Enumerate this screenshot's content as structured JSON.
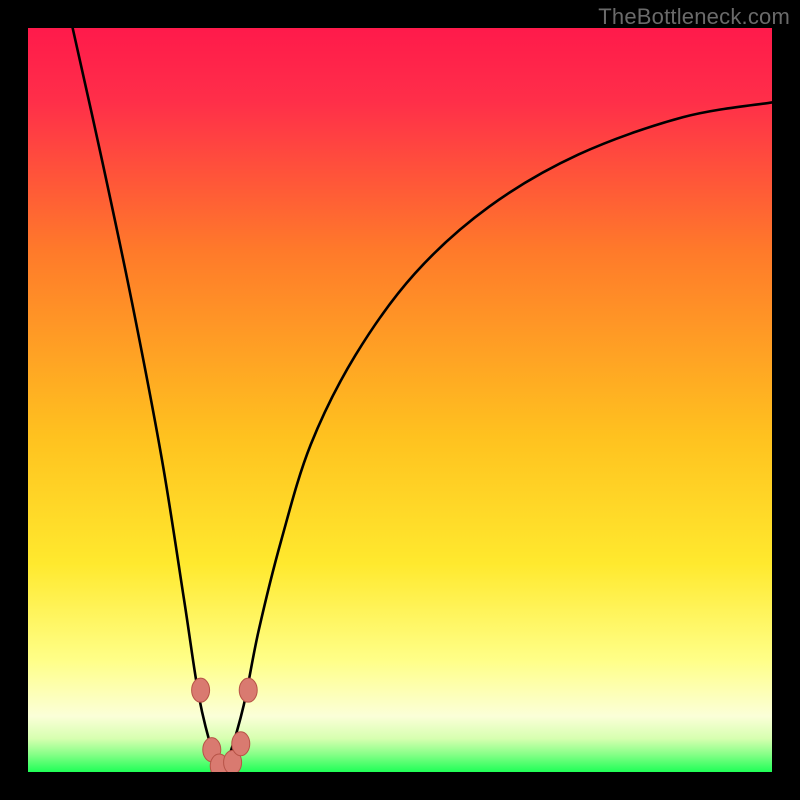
{
  "watermark": "TheBottleneck.com",
  "colors": {
    "bg_black": "#000000",
    "grad_top": "#ff1a4b",
    "grad_mid1": "#ff7a2a",
    "grad_mid2": "#ffd21f",
    "grad_mid3": "#ffff66",
    "grad_low": "#f7ffd0",
    "grad_green": "#2bff63",
    "curve": "#000000",
    "marker_fill": "#d97a70",
    "marker_stroke": "#b75347"
  },
  "chart_data": {
    "type": "line",
    "title": "",
    "xlabel": "",
    "ylabel": "",
    "xlim": [
      0,
      100
    ],
    "ylim": [
      0,
      100
    ],
    "grid": false,
    "note": "V-shaped bottleneck deviation curve on a red→green vertical heat gradient. Y≈100 is worst (red), Y≈0 is best (green). Minimum (optimal point) sits near x≈26. Values are read off the plot by vertical position against the gradient; no numeric axes are drawn.",
    "series": [
      {
        "name": "bottleneck-curve",
        "x": [
          6,
          10,
          14,
          18,
          21,
          23,
          25,
          26,
          27,
          29,
          31,
          34,
          38,
          44,
          52,
          62,
          74,
          88,
          100
        ],
        "y": [
          100,
          82,
          63,
          42,
          23,
          10,
          2,
          0,
          2,
          9,
          19,
          31,
          44,
          56,
          67,
          76,
          83,
          88,
          90
        ]
      }
    ],
    "markers": [
      {
        "name": "left-shoulder-upper",
        "x": 23.2,
        "y": 11
      },
      {
        "name": "right-shoulder-upper",
        "x": 29.6,
        "y": 11
      },
      {
        "name": "left-shoulder-lower",
        "x": 24.7,
        "y": 3.0
      },
      {
        "name": "valley-left",
        "x": 25.7,
        "y": 0.8
      },
      {
        "name": "valley-right",
        "x": 27.5,
        "y": 1.3
      },
      {
        "name": "right-shoulder-lower",
        "x": 28.6,
        "y": 3.8
      }
    ]
  }
}
